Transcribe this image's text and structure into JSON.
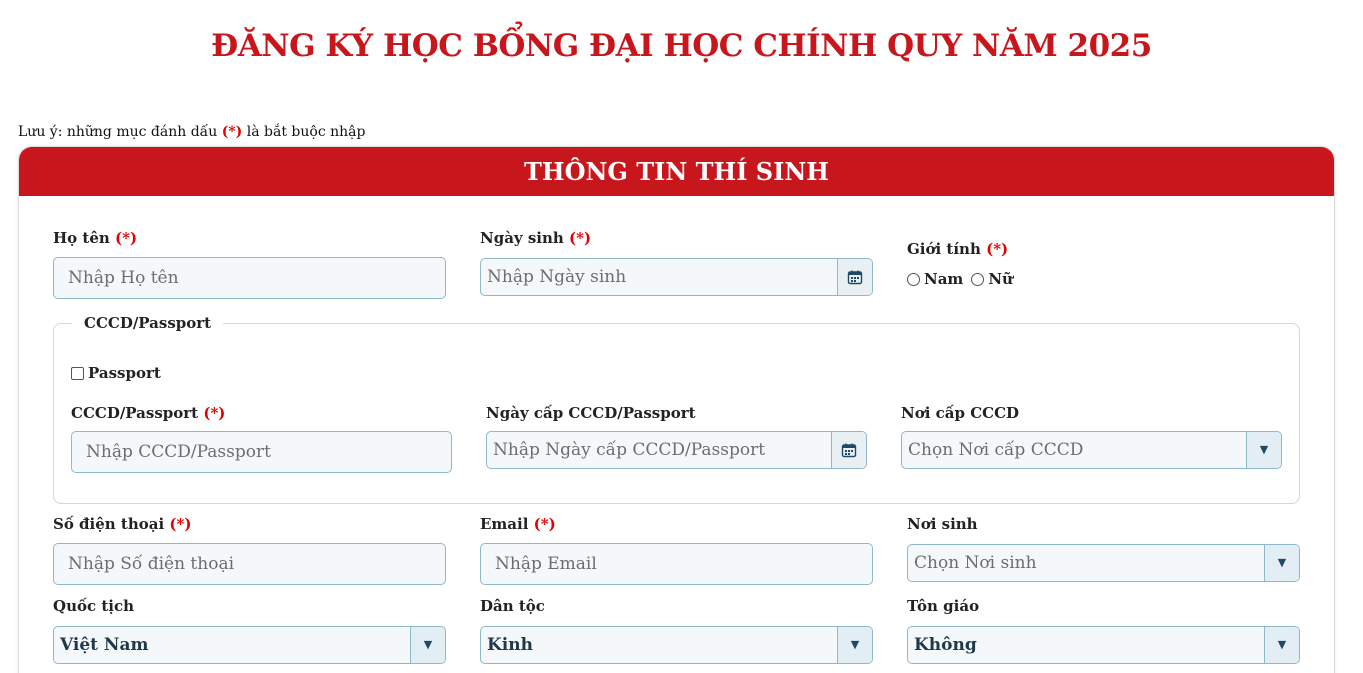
{
  "page": {
    "title": "ĐĂNG KÝ HỌC BỔNG ĐẠI HỌC CHÍNH QUY NĂM 2025",
    "note_prefix": "Lưu ý: những mục đánh dấu",
    "note_required_mark": "(*)",
    "note_suffix": "là bắt buộc nhập"
  },
  "section": {
    "header": "THÔNG TIN THÍ SINH"
  },
  "required_mark": "(*)",
  "fields": {
    "ho_ten": {
      "label": "Họ tên",
      "placeholder": "Nhập Họ tên"
    },
    "ngay_sinh": {
      "label": "Ngày sinh",
      "placeholder": "Nhập Ngày sinh"
    },
    "gioi_tinh": {
      "label": "Giới tính",
      "options": [
        "Nam",
        "Nữ"
      ]
    },
    "cccd_group": {
      "legend": "CCCD/Passport",
      "passport_checkbox": "Passport",
      "cccd": {
        "label": "CCCD/Passport",
        "placeholder": "Nhập CCCD/Passport"
      },
      "ngay_cap": {
        "label": "Ngày cấp CCCD/Passport",
        "placeholder": "Nhập Ngày cấp CCCD/Passport"
      },
      "noi_cap": {
        "label": "Nơi cấp CCCD",
        "placeholder": "Chọn Nơi cấp CCCD"
      }
    },
    "so_dien_thoai": {
      "label": "Số điện thoại",
      "placeholder": "Nhập Số điện thoại"
    },
    "email": {
      "label": "Email",
      "placeholder": "Nhập Email"
    },
    "noi_sinh": {
      "label": "Nơi sinh",
      "placeholder": "Chọn Nơi sinh"
    },
    "quoc_tich": {
      "label": "Quốc tịch",
      "value": "Việt Nam"
    },
    "dan_toc": {
      "label": "Dân tộc",
      "value": "Kinh"
    },
    "ton_giao": {
      "label": "Tôn giáo",
      "value": "Không"
    }
  },
  "icons": {
    "calendar": "calendar-icon",
    "dropdown": "chevron-down-icon"
  },
  "colors": {
    "brand_red": "#c8161d",
    "required_red": "#e00000",
    "input_border": "#8fb8c9"
  }
}
